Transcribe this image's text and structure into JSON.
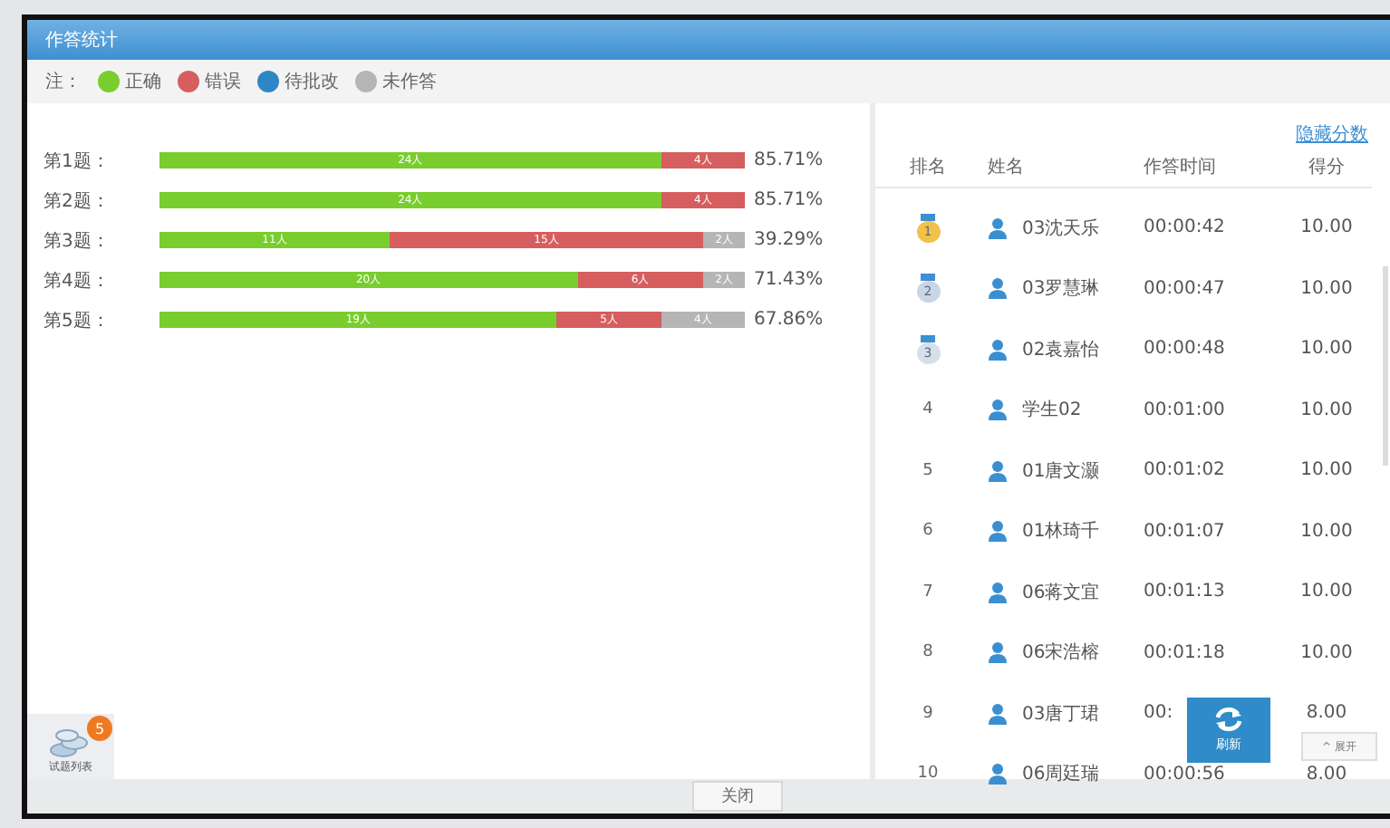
{
  "window": {
    "title": "作答统计"
  },
  "legend": {
    "label": "注：",
    "items": [
      {
        "kind": "correct",
        "label": "正确"
      },
      {
        "kind": "wrong",
        "label": "错误"
      },
      {
        "kind": "pending",
        "label": "待批改"
      },
      {
        "kind": "unanswered",
        "label": "未作答"
      }
    ]
  },
  "questions": [
    {
      "label": "第1题：",
      "rate": "85.71%",
      "segments": [
        {
          "kind": "correct",
          "level": 0.857,
          "label": "24人"
        },
        {
          "kind": "wrong",
          "level": 1.0,
          "label": "4人"
        }
      ]
    },
    {
      "label": "第2题：",
      "rate": "85.71%",
      "segments": [
        {
          "kind": "correct",
          "level": 0.857,
          "label": "24人"
        },
        {
          "kind": "wrong",
          "level": 1.0,
          "label": "4人"
        }
      ]
    },
    {
      "label": "第3题：",
      "rate": "39.29%",
      "segments": [
        {
          "kind": "correct",
          "level": 0.393,
          "label": "11人"
        },
        {
          "kind": "wrong",
          "level": 0.929,
          "label": "15人"
        },
        {
          "kind": "unanswered",
          "level": 1.0,
          "label": "2人"
        }
      ]
    },
    {
      "label": "第4题：",
      "rate": "71.43%",
      "segments": [
        {
          "kind": "correct",
          "level": 0.714,
          "label": "20人"
        },
        {
          "kind": "wrong",
          "level": 0.929,
          "label": "6人"
        },
        {
          "kind": "unanswered",
          "level": 1.0,
          "label": "2人"
        }
      ]
    },
    {
      "label": "第5题：",
      "rate": "67.86%",
      "segments": [
        {
          "kind": "correct",
          "level": 0.679,
          "label": "19人"
        },
        {
          "kind": "wrong",
          "level": 0.857,
          "label": "5人"
        },
        {
          "kind": "unanswered",
          "level": 1.0,
          "label": "4人"
        }
      ]
    }
  ],
  "question_list_button": {
    "label": "试题列表",
    "badge": "5"
  },
  "ranking": {
    "hide_scores_link": "隐藏分数",
    "columns": [
      "排名",
      "姓名",
      "作答时间",
      "得分"
    ],
    "rows": [
      {
        "rank": "1",
        "kind": "medal",
        "name": "03沈天乐",
        "time": "00:00:42",
        "score": "10.00"
      },
      {
        "rank": "2",
        "kind": "medal",
        "name": "03罗慧琳",
        "time": "00:00:47",
        "score": "10.00"
      },
      {
        "rank": "3",
        "kind": "medal",
        "name": "02袁嘉怡",
        "time": "00:00:48",
        "score": "10.00"
      },
      {
        "rank": "4",
        "kind": "plain",
        "name": "学生02",
        "time": "00:01:00",
        "score": "10.00"
      },
      {
        "rank": "5",
        "kind": "plain",
        "name": "01唐文灏",
        "time": "00:01:02",
        "score": "10.00"
      },
      {
        "rank": "6",
        "kind": "plain",
        "name": "01林琦千",
        "time": "00:01:07",
        "score": "10.00"
      },
      {
        "rank": "7",
        "kind": "plain",
        "name": "06蒋文宜",
        "time": "00:01:13",
        "score": "10.00"
      },
      {
        "rank": "8",
        "kind": "plain",
        "name": "06宋浩榕",
        "time": "00:01:18",
        "score": "10.00"
      },
      {
        "rank": "9",
        "kind": "plain",
        "name": "03唐丁珺",
        "time": "00:",
        "score": "8.00"
      },
      {
        "rank": "10",
        "kind": "plain",
        "name": "06周廷瑞",
        "time": "00:00:56",
        "score": "8.00"
      }
    ]
  },
  "refresh_button": {
    "label": "刷新"
  },
  "expand_button": {
    "label": "^ 展开"
  },
  "footer": {
    "close_button": "关闭"
  }
}
